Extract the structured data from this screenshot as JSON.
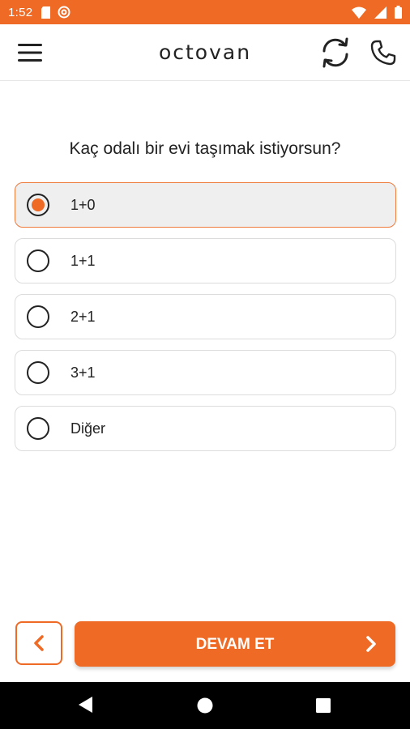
{
  "status_bar": {
    "time": "1:52"
  },
  "app_bar": {
    "logo_text": "octovan"
  },
  "question": {
    "text": "Kaç odalı bir evi taşımak istiyorsun?"
  },
  "options": [
    {
      "label": "1+0",
      "selected": true
    },
    {
      "label": "1+1",
      "selected": false
    },
    {
      "label": "2+1",
      "selected": false
    },
    {
      "label": "3+1",
      "selected": false
    },
    {
      "label": "Diğer",
      "selected": false
    }
  ],
  "footer": {
    "continue_label": "DEVAM ET"
  },
  "colors": {
    "accent": "#ee6a25",
    "text": "#222222",
    "selected_bg": "#efefef"
  }
}
